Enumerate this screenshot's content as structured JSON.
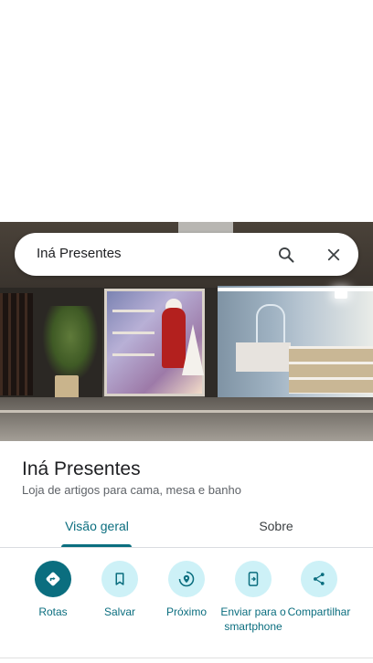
{
  "search": {
    "query": "Iná Presentes",
    "search_icon": "search-icon",
    "close_icon": "close-icon"
  },
  "place": {
    "name": "Iná Presentes",
    "category": "Loja de artigos para cama, mesa e banho",
    "photo": "storefront-photo"
  },
  "tabs": [
    {
      "label": "Visão geral",
      "selected": true
    },
    {
      "label": "Sobre",
      "selected": false
    }
  ],
  "actions": [
    {
      "label": "Rotas",
      "icon": "directions-icon"
    },
    {
      "label": "Salvar",
      "icon": "bookmark-icon"
    },
    {
      "label": "Próximo",
      "icon": "nearby-icon"
    },
    {
      "label": "Enviar para o smartphone",
      "icon": "send-to-phone-icon"
    },
    {
      "label": "Compartilhar",
      "icon": "share-icon"
    }
  ],
  "colors": {
    "accent": "#0b6e7f",
    "action_bg": "#cdf1f7",
    "text_primary": "#202124",
    "text_secondary": "#5f6368"
  }
}
